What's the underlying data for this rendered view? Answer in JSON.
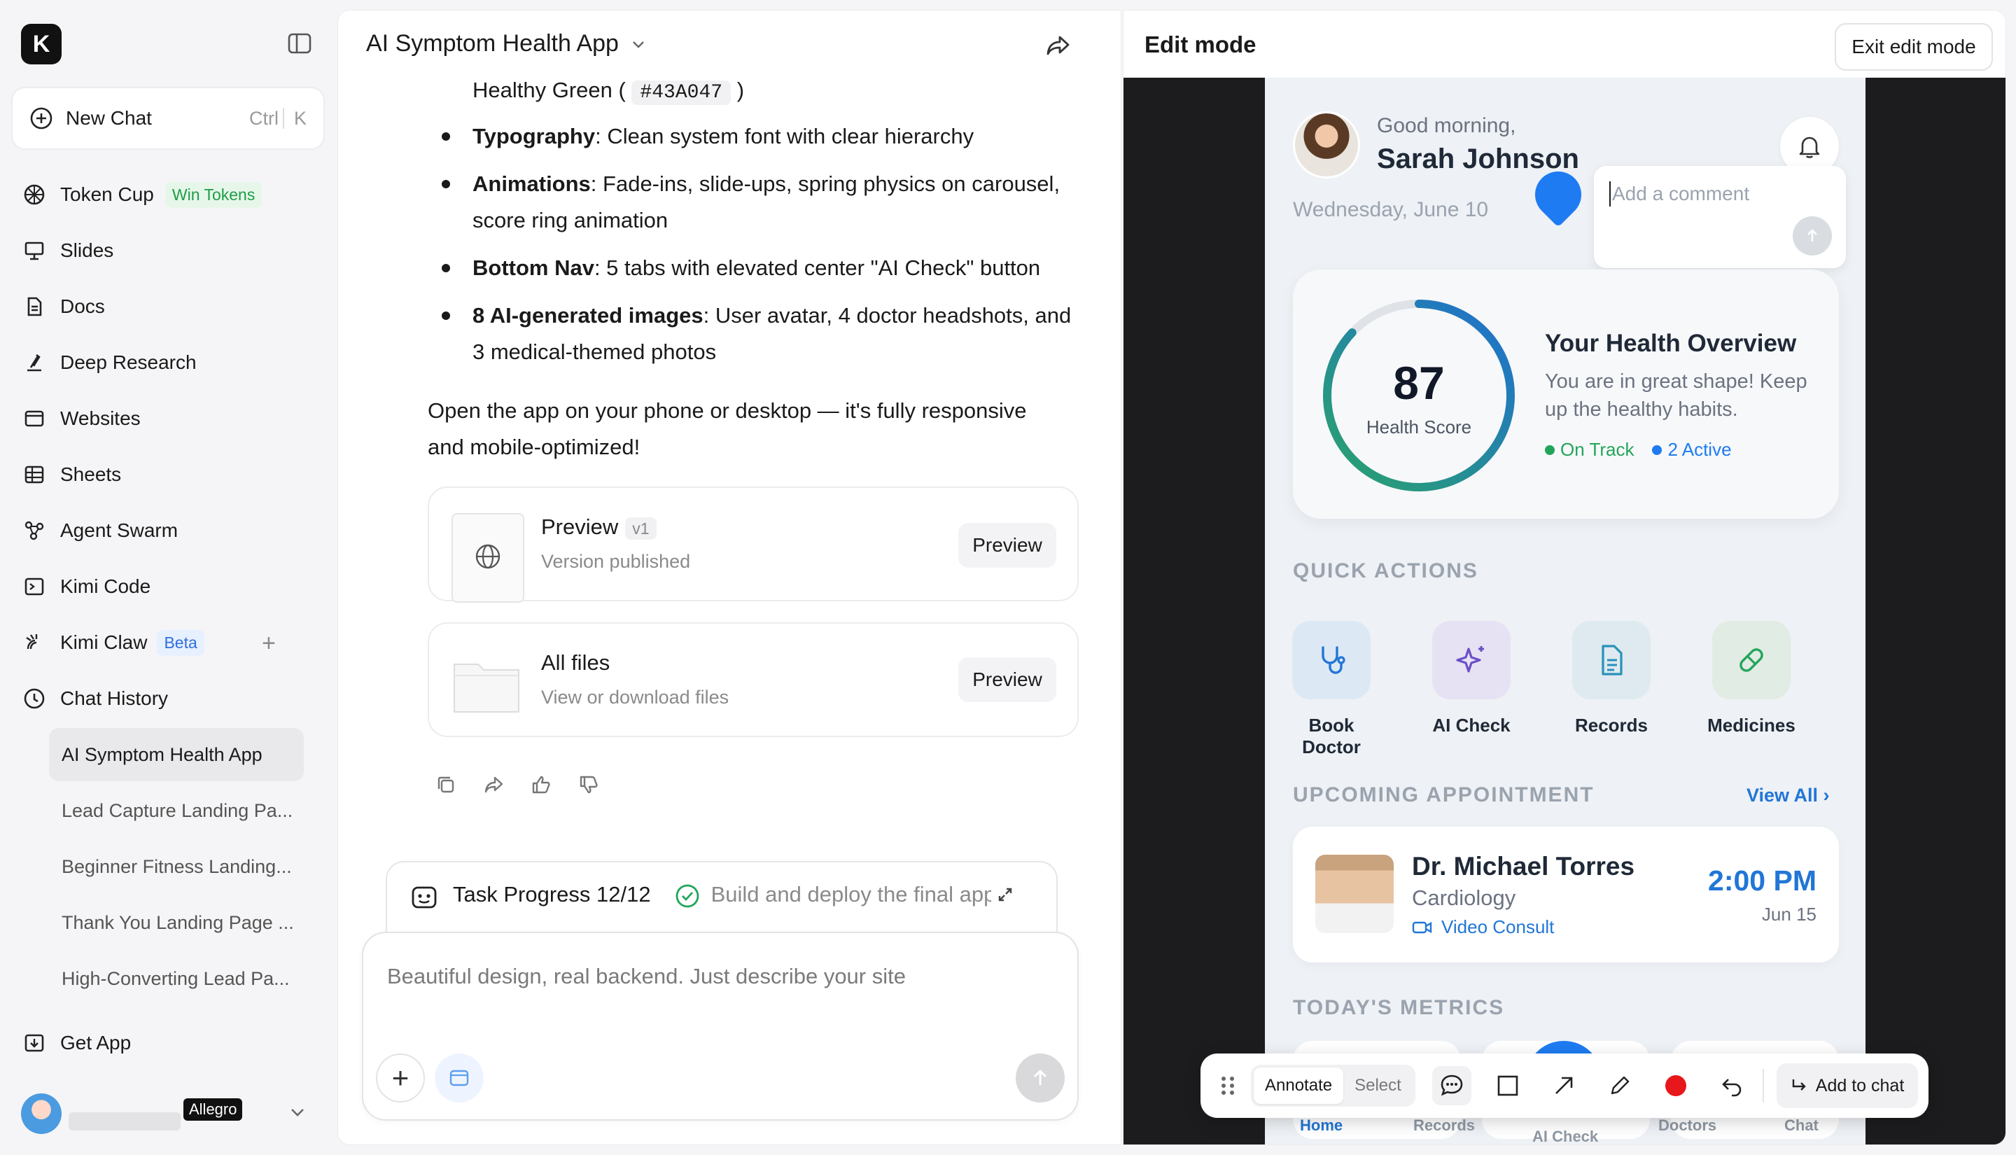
{
  "sidebar": {
    "logo": "K",
    "new_chat": {
      "label": "New Chat",
      "kbd1": "Ctrl",
      "kbd2": "K"
    },
    "items": [
      {
        "label": "Token Cup",
        "badge": "Win Tokens",
        "icon": "cup-icon"
      },
      {
        "label": "Slides",
        "icon": "slides-icon"
      },
      {
        "label": "Docs",
        "icon": "docs-icon"
      },
      {
        "label": "Deep Research",
        "icon": "research-icon"
      },
      {
        "label": "Websites",
        "icon": "websites-icon"
      },
      {
        "label": "Sheets",
        "icon": "sheets-icon"
      },
      {
        "label": "Agent Swarm",
        "icon": "swarm-icon"
      },
      {
        "label": "Kimi Code",
        "icon": "terminal-icon"
      },
      {
        "label": "Kimi Claw",
        "badge": "Beta",
        "icon": "claw-icon"
      },
      {
        "label": "Chat History",
        "icon": "clock-icon"
      }
    ],
    "history": [
      "AI Symptom Health App",
      "Lead Capture Landing Pa...",
      "Beginner Fitness Landing...",
      "Thank You Landing Page ...",
      "High-Converting Lead Pa..."
    ],
    "get_app": "Get App",
    "user_badge": "Allegro"
  },
  "chat": {
    "title": "AI Symptom Health App",
    "line_top_text": "Healthy Green (",
    "line_top_code": "#43A047",
    "line_top_end": ")",
    "bullets": [
      {
        "bold": "Typography",
        "rest": ": Clean system font with clear hierarchy",
        "rest2": ""
      },
      {
        "bold": "Animations",
        "rest": ": Fade-ins, slide-ups, spring physics on carousel,",
        "rest2": "score ring animation"
      },
      {
        "bold": "Bottom Nav",
        "rest": ": 5 tabs with elevated center \"AI Check\" button",
        "rest2": ""
      },
      {
        "bold": "8 AI-generated images",
        "rest": ": User avatar, 4 doctor headshots, and",
        "rest2": "3 medical-themed photos"
      }
    ],
    "paragraph_1": "Open the app on your phone or desktop — it's fully responsive",
    "paragraph_2": "and mobile-optimized!",
    "preview_card": {
      "title": "Preview",
      "version": "v1",
      "sub": "Version published",
      "button": "Preview"
    },
    "files_card": {
      "title": "All files",
      "sub": "View or download files",
      "button": "Preview"
    },
    "task": {
      "label": "Task Progress 12/12",
      "step": "Build and deploy the final app"
    },
    "composer_placeholder": "Beautiful design, real backend. Just describe your site"
  },
  "edit": {
    "title": "Edit mode",
    "exit_button": "Exit edit mode",
    "app": {
      "greeting": "Good morning,",
      "name": "Sarah Johnson",
      "date": "Wednesday, June 10",
      "comment_placeholder": "Add a comment",
      "score": "87",
      "score_percent": 87,
      "score_label": "Health Score",
      "overview_title": "Your Health Overview",
      "overview_text": "You are in great shape! Keep up the healthy habits.",
      "tag_1": "On Track",
      "tag_2": "2 Active",
      "quick_actions_title": "QUICK ACTIONS",
      "quick_actions": [
        "Book Doctor",
        "AI Check",
        "Records",
        "Medicines"
      ],
      "upcoming_title": "UPCOMING APPOINTMENT",
      "view_all": "View All ›",
      "appointment": {
        "doctor": "Dr. Michael Torres",
        "specialty": "Cardiology",
        "type": "Video Consult",
        "time": "2:00 PM",
        "date": "Jun 15"
      },
      "metrics_title": "TODAY'S METRICS",
      "bottom_nav": [
        "Home",
        "Records",
        "AI Check",
        "Doctors",
        "Chat"
      ],
      "colors": {
        "accent": "#1e7bf2",
        "green": "#22a55a",
        "ring_start": "#2aa36b",
        "ring_end": "#1f6fd1"
      }
    },
    "toolbar": {
      "annotate": "Annotate",
      "select": "Select",
      "add_to_chat": "Add to chat"
    }
  }
}
